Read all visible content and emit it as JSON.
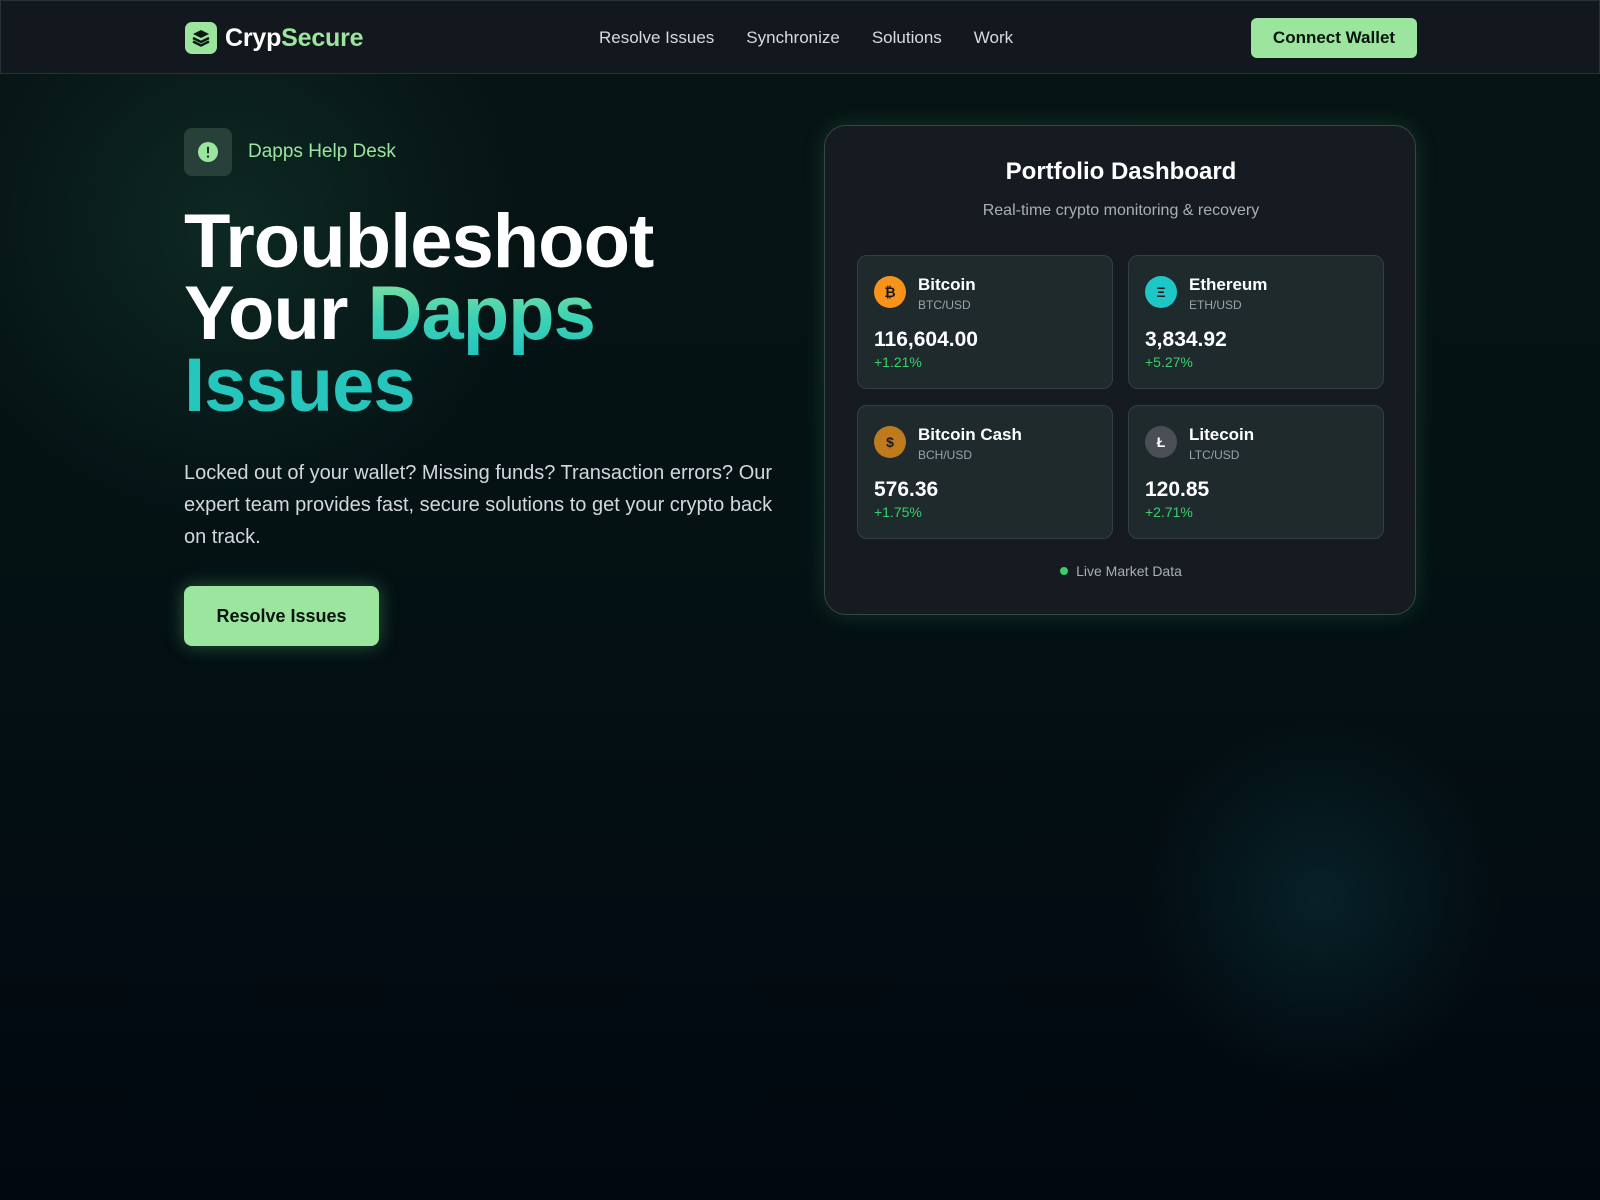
{
  "nav": {
    "brand_part1": "Cryp",
    "brand_part2": "Secure",
    "brand_icon": "layers-icon",
    "links": [
      "Resolve Issues",
      "Synchronize",
      "Solutions",
      "Work"
    ],
    "cta_label": "Connect Wallet"
  },
  "hero": {
    "badge_label": "Dapps Help Desk",
    "badge_icon": "alert-circle-icon",
    "title_line1": "Troubleshoot",
    "title_line2_a": "Your ",
    "title_line2_b": "Dapps",
    "title_line3": "Issues",
    "description": "Locked out of your wallet? Missing funds? Transaction errors? Our expert team provides fast, secure solutions to get your crypto back on track.",
    "cta_label": "Resolve Issues"
  },
  "dashboard": {
    "title": "Portfolio Dashboard",
    "subtitle": "Real-time crypto monitoring & recovery",
    "coins": [
      {
        "name": "Bitcoin",
        "pair": "BTC/USD",
        "price": "116,604.00",
        "change": "+1.21%",
        "symbol": "₿",
        "color": "#f7931a"
      },
      {
        "name": "Ethereum",
        "pair": "ETH/USD",
        "price": "3,834.92",
        "change": "+5.27%",
        "symbol": "Ξ",
        "color": "#1fc6c6"
      },
      {
        "name": "Bitcoin Cash",
        "pair": "BCH/USD",
        "price": "576.36",
        "change": "+1.75%",
        "symbol": "$",
        "color": "#c07a1e"
      },
      {
        "name": "Litecoin",
        "pair": "LTC/USD",
        "price": "120.85",
        "change": "+2.71%",
        "symbol": "Ł",
        "color": "#4a4f55"
      }
    ],
    "live_label": "Live Market Data"
  },
  "colors": {
    "accent": "#9be59f",
    "positive": "#38cf6b",
    "teal": "#26c6bd"
  }
}
